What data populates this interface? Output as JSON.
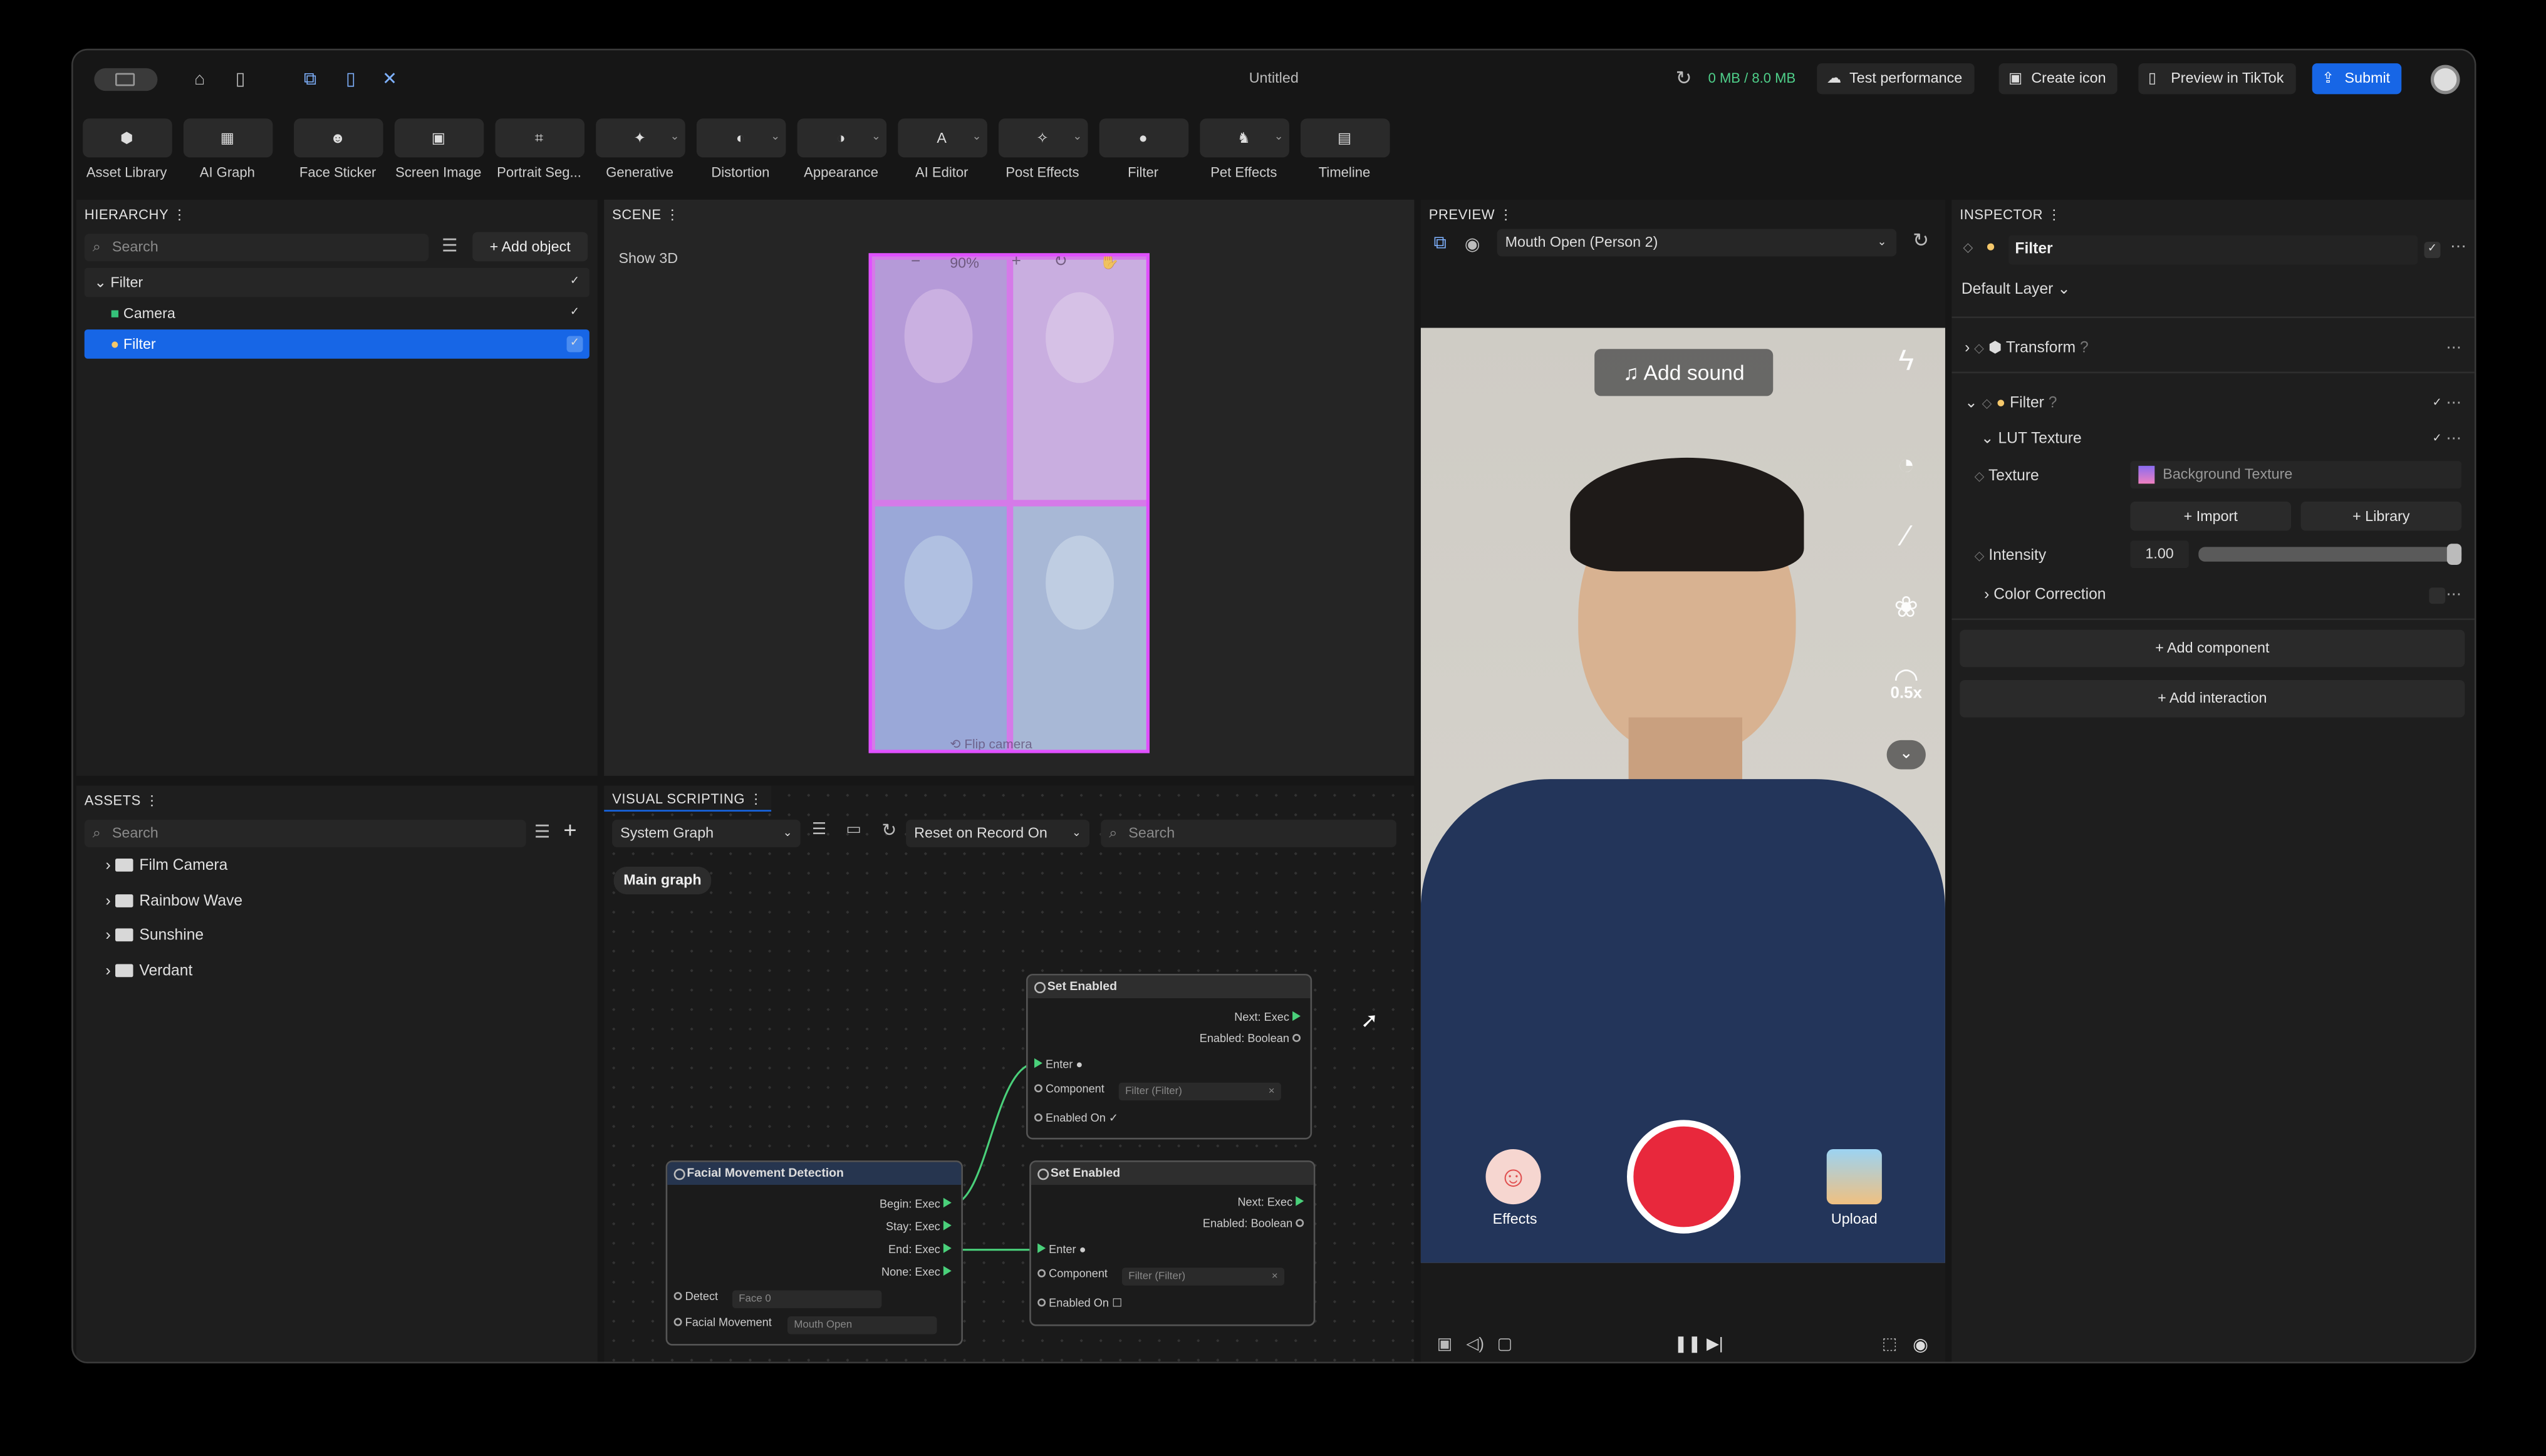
{
  "window": {
    "title": "Untitled"
  },
  "header": {
    "memory": "0 MB / 8.0 MB",
    "test_performance": "Test performance",
    "create_icon": "Create icon",
    "preview_tiktok": "Preview in TikTok",
    "submit": "Submit"
  },
  "toolbar": {
    "items": [
      {
        "label": "Asset Library",
        "icon": "asset-library-icon"
      },
      {
        "label": "AI Graph",
        "icon": "ai-graph-icon"
      },
      {
        "label": "Face Sticker",
        "icon": "face-sticker-icon"
      },
      {
        "label": "Screen Image",
        "icon": "screen-image-icon"
      },
      {
        "label": "Portrait Seg...",
        "icon": "portrait-seg-icon"
      },
      {
        "label": "Generative",
        "icon": "generative-icon"
      },
      {
        "label": "Distortion",
        "icon": "distortion-icon"
      },
      {
        "label": "Appearance",
        "icon": "appearance-icon"
      },
      {
        "label": "AI Editor",
        "icon": "ai-editor-icon"
      },
      {
        "label": "Post Effects",
        "icon": "post-effects-icon"
      },
      {
        "label": "Filter",
        "icon": "filter-icon"
      },
      {
        "label": "Pet Effects",
        "icon": "pet-effects-icon"
      },
      {
        "label": "Timeline",
        "icon": "timeline-icon"
      }
    ]
  },
  "hierarchy": {
    "title": "HIERARCHY",
    "search_placeholder": "Search",
    "add_object": "Add object",
    "items": [
      {
        "label": "Filter"
      },
      {
        "label": "Camera"
      },
      {
        "label": "Filter"
      }
    ]
  },
  "scene": {
    "title": "SCENE",
    "show3d": "Show 3D",
    "zoom": "90%",
    "flip_camera": "Flip camera"
  },
  "preview": {
    "title": "PREVIEW",
    "select": "Mouth Open (Person 2)",
    "add_sound": "Add sound",
    "speed": "0.5x",
    "effects": "Effects",
    "upload": "Upload"
  },
  "inspector": {
    "title": "INSPECTOR",
    "object_name": "Filter",
    "layer": "Default Layer",
    "transform": "Transform",
    "filter": "Filter",
    "lut_texture": "LUT Texture",
    "texture_label": "Texture",
    "texture_value": "Background Texture",
    "import": "+ Import",
    "library": "+ Library",
    "intensity_label": "Intensity",
    "intensity_value": "1.00",
    "intensity_level": 1.0,
    "color_correction": "Color Correction",
    "add_component": "Add component",
    "add_interaction": "Add interaction"
  },
  "assets": {
    "title": "ASSETS",
    "search_placeholder": "Search",
    "items": [
      {
        "label": "Film Camera"
      },
      {
        "label": "Rainbow Wave"
      },
      {
        "label": "Sunshine"
      },
      {
        "label": "Verdant"
      }
    ]
  },
  "visual_scripting": {
    "title": "VISUAL SCRIPTING",
    "graph_select": "System Graph",
    "reset_select": "Reset on Record On",
    "search_placeholder": "Search",
    "main_graph": "Main graph",
    "nodes": {
      "set1": {
        "title": "Set Enabled",
        "next": "Next: Exec",
        "enabled_bool": "Enabled: Boolean",
        "enter": "Enter",
        "component": "Component",
        "component_value": "Filter (Filter)",
        "enabled_on": "Enabled On"
      },
      "set2": {
        "title": "Set Enabled",
        "next": "Next: Exec",
        "enabled_bool": "Enabled: Boolean",
        "enter": "Enter",
        "component": "Component",
        "component_value": "Filter (Filter)",
        "enabled_on": "Enabled On"
      },
      "fmd": {
        "title": "Facial Movement Detection",
        "begin": "Begin: Exec",
        "stay": "Stay: Exec",
        "end": "End: Exec",
        "none": "None: Exec",
        "detect": "Detect",
        "detect_value": "Face 0",
        "facial_movement": "Facial Movement",
        "facial_movement_value": "Mouth Open"
      }
    }
  },
  "colors": {
    "accent": "#1766e6",
    "record": "#e8283c",
    "node_green": "#4ad07a"
  }
}
